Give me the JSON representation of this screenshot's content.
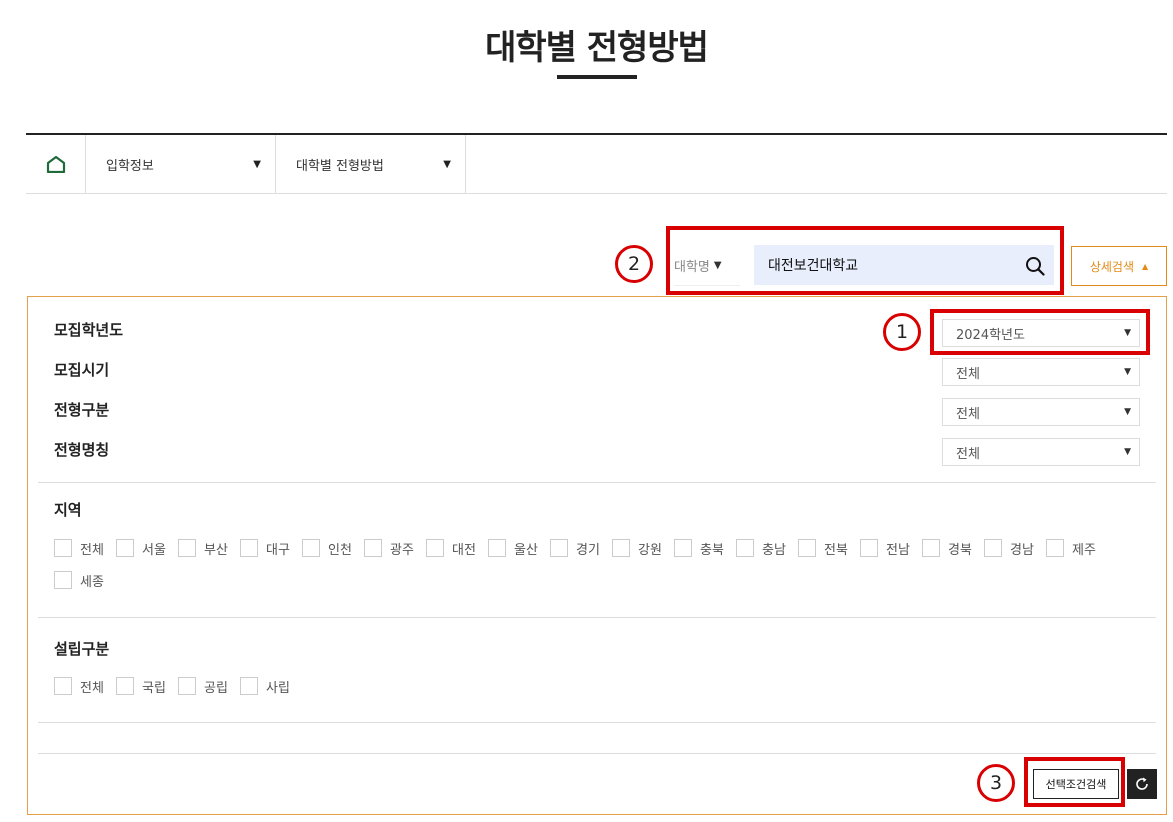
{
  "page_title": "대학별 전형방법",
  "breadcrumb": {
    "home_icon": "home-icon",
    "items": [
      {
        "label": "입학정보"
      },
      {
        "label": "대학별 전형방법"
      }
    ]
  },
  "search": {
    "type_label": "대학명",
    "value": "대전보건대학교",
    "detail_button": "상세검색"
  },
  "filters": [
    {
      "label": "모집학년도",
      "selected": "2024학년도"
    },
    {
      "label": "모집시기",
      "selected": "전체"
    },
    {
      "label": "전형구분",
      "selected": "전체"
    },
    {
      "label": "전형명칭",
      "selected": "전체"
    }
  ],
  "region": {
    "title": "지역",
    "options": [
      "전체",
      "서울",
      "부산",
      "대구",
      "인천",
      "광주",
      "대전",
      "울산",
      "경기",
      "강원",
      "충북",
      "충남",
      "전북",
      "전남",
      "경북",
      "경남",
      "제주",
      "세종"
    ]
  },
  "establishment": {
    "title": "설립구분",
    "options": [
      "전체",
      "국립",
      "공립",
      "사립"
    ]
  },
  "actions": {
    "search_selected": "선택조건검색"
  },
  "annotations": [
    "1",
    "2",
    "3"
  ],
  "colors": {
    "accent": "#e38b1a",
    "highlight": "#d80000",
    "home_icon": "#1f6b3a",
    "search_bg": "#e8eefc"
  }
}
